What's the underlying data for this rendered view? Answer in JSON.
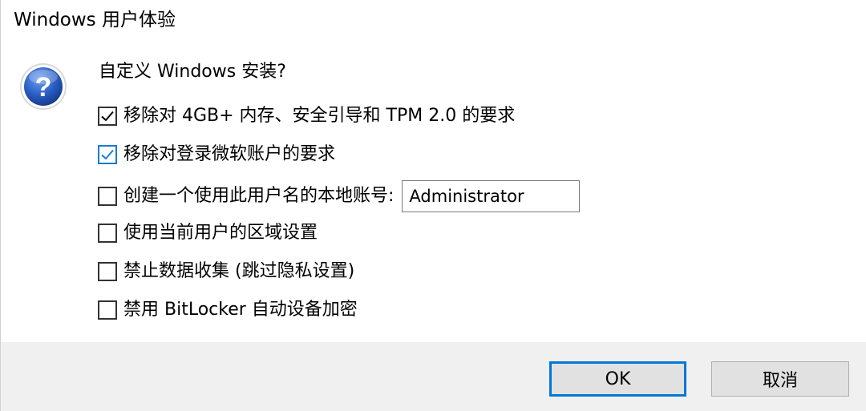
{
  "window": {
    "title": "Windows 用户体验"
  },
  "dialog": {
    "icon": "question-icon",
    "prompt": "自定义 Windows 安装?",
    "options": [
      {
        "label": "移除对 4GB+ 内存、安全引导和 TPM 2.0 的要求",
        "checked": true
      },
      {
        "label": "移除对登录微软账户的要求",
        "checked": true
      },
      {
        "label": "创建一个使用此用户名的本地账号:",
        "checked": false
      },
      {
        "label": "使用当前用户的区域设置",
        "checked": false
      },
      {
        "label": "禁止数据收集 (跳过隐私设置)",
        "checked": false
      },
      {
        "label": "禁用 BitLocker 自动设备加密",
        "checked": false
      }
    ],
    "username_value": "Administrator"
  },
  "footer": {
    "ok_label": "OK",
    "cancel_label": "取消"
  },
  "colors": {
    "accent": "#0078d7",
    "footer_bg": "#f0f0f0",
    "icon_blue": "#2a5ec4"
  }
}
